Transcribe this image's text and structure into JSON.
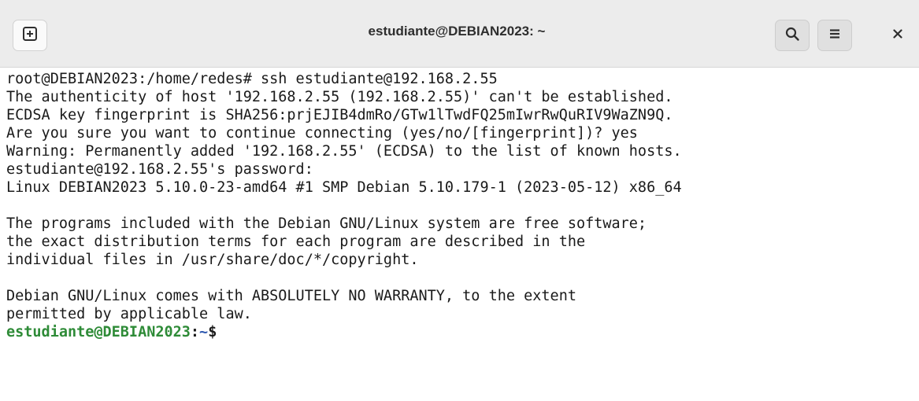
{
  "window": {
    "title": "estudiante@DEBIAN2023: ~",
    "close_symbol": "×"
  },
  "icons": {
    "new_tab": "new-tab-icon",
    "search": "search-icon",
    "menu": "hamburger-menu-icon",
    "close": "close-icon"
  },
  "colors": {
    "titlebar_bg": "#ececec",
    "terminal_bg": "#ffffff",
    "text": "#1a1a1a",
    "prompt_user": "#2e8b37",
    "prompt_path": "#2f59b0"
  },
  "terminal": {
    "lines": [
      "root@DEBIAN2023:/home/redes# ssh estudiante@192.168.2.55",
      "The authenticity of host '192.168.2.55 (192.168.2.55)' can't be established.",
      "ECDSA key fingerprint is SHA256:prjEJIB4dmRo/GTw1lTwdFQ25mIwrRwQuRIV9WaZN9Q.",
      "Are you sure you want to continue connecting (yes/no/[fingerprint])? yes",
      "Warning: Permanently added '192.168.2.55' (ECDSA) to the list of known hosts.",
      "estudiante@192.168.2.55's password:",
      "Linux DEBIAN2023 5.10.0-23-amd64 #1 SMP Debian 5.10.179-1 (2023-05-12) x86_64",
      "",
      "The programs included with the Debian GNU/Linux system are free software;",
      "the exact distribution terms for each program are described in the",
      "individual files in /usr/share/doc/*/copyright.",
      "",
      "Debian GNU/Linux comes with ABSOLUTELY NO WARRANTY, to the extent",
      "permitted by applicable law."
    ],
    "prompt": {
      "user_host": "estudiante@DEBIAN2023",
      "separator": ":",
      "path": "~",
      "symbol": "$"
    }
  }
}
